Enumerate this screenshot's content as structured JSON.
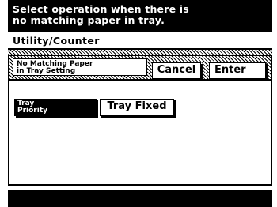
{
  "message": {
    "line1": "Select operation when there is",
    "line2": "no matching paper in tray."
  },
  "path": {
    "label": "Utility/Counter"
  },
  "setting": {
    "title_line1": "No Matching Paper",
    "title_line2": "in Tray Setting"
  },
  "buttons": {
    "cancel": "Cancel",
    "enter": "Enter"
  },
  "options": {
    "tray_priority_line1": "Tray",
    "tray_priority_line2": "Priority",
    "tray_fixed": "Tray Fixed",
    "selected": "Tray Priority"
  }
}
